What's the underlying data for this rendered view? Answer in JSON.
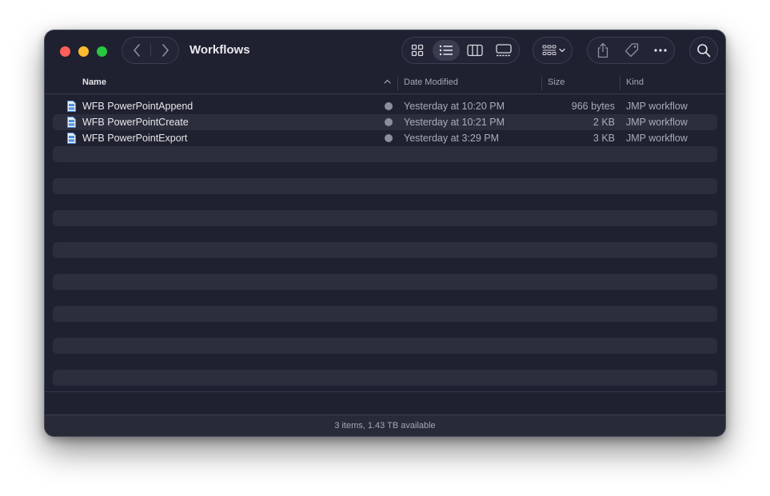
{
  "window": {
    "title": "Workflows",
    "view_mode": "list",
    "status_text": "3 items, 1.43 TB available"
  },
  "icons": {
    "back": "chevron-left-icon",
    "forward": "chevron-right-icon",
    "views": [
      "icon-view-grid-icon",
      "list-view-icon",
      "column-view-icon",
      "gallery-view-icon"
    ],
    "group": "group-by-icon",
    "share": "share-icon",
    "tag": "tag-icon",
    "more": "more-ellipsis-icon",
    "search": "search-icon"
  },
  "columns": {
    "name": "Name",
    "date": "Date Modified",
    "size": "Size",
    "kind": "Kind"
  },
  "files": [
    {
      "name": "WFB PowerPointAppend",
      "date": "Yesterday at 10:20 PM",
      "size": "966 bytes",
      "kind": "JMP workflow"
    },
    {
      "name": "WFB PowerPointCreate",
      "date": "Yesterday at 10:21 PM",
      "size": "2 KB",
      "kind": "JMP workflow"
    },
    {
      "name": "WFB PowerPointExport",
      "date": "Yesterday at 3:29 PM",
      "size": "3 KB",
      "kind": "JMP workflow"
    }
  ],
  "colors": {
    "window_bg": "#1f2130",
    "alt_row": "#2c2e3d",
    "traffic_red": "#fe5f57",
    "traffic_yellow": "#febc2e",
    "traffic_green": "#28c840",
    "file_icon": "#4a90e2"
  }
}
